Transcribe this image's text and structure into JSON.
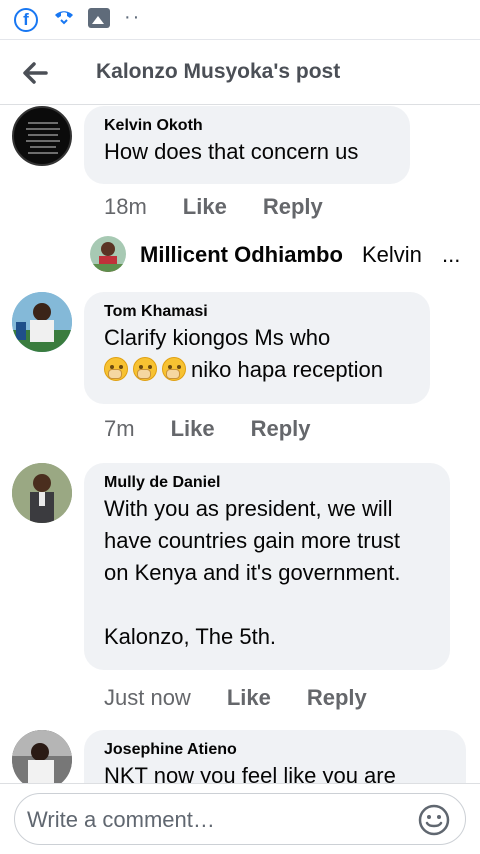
{
  "header": {
    "title": "Kalonzo Musyoka's post"
  },
  "status_icons": [
    "facebook-icon",
    "call-icon",
    "image-icon",
    "more-icon"
  ],
  "comments": [
    {
      "author": "Kelvin Okoth",
      "lines": [
        "How does that concern  us"
      ],
      "time": "18m",
      "like": "Like",
      "reply": "Reply",
      "reply_preview": {
        "author": "Millicent Odhiambo",
        "text": "Kelvin",
        "ellipsis": "..."
      }
    },
    {
      "author": "Tom Khamasi",
      "lines": [
        "Clarify kiongos Ms who",
        "niko hapa reception"
      ],
      "emoji_count": 3,
      "time": "7m",
      "like": "Like",
      "reply": "Reply"
    },
    {
      "author": "Mully de Daniel",
      "lines": [
        "With you as president, we will",
        "have countries gain more trust",
        "on Kenya and it's government.",
        "",
        "Kalonzo, The 5th."
      ],
      "time": "Just now",
      "like": "Like",
      "reply": "Reply"
    },
    {
      "author": "Josephine Atieno",
      "lines": [
        "NKT now you feel like you are"
      ]
    }
  ],
  "composer": {
    "placeholder": "Write a comment…"
  },
  "colors": {
    "accent": "#1877f2",
    "bubble": "#f0f2f5",
    "meta": "#65676b"
  }
}
